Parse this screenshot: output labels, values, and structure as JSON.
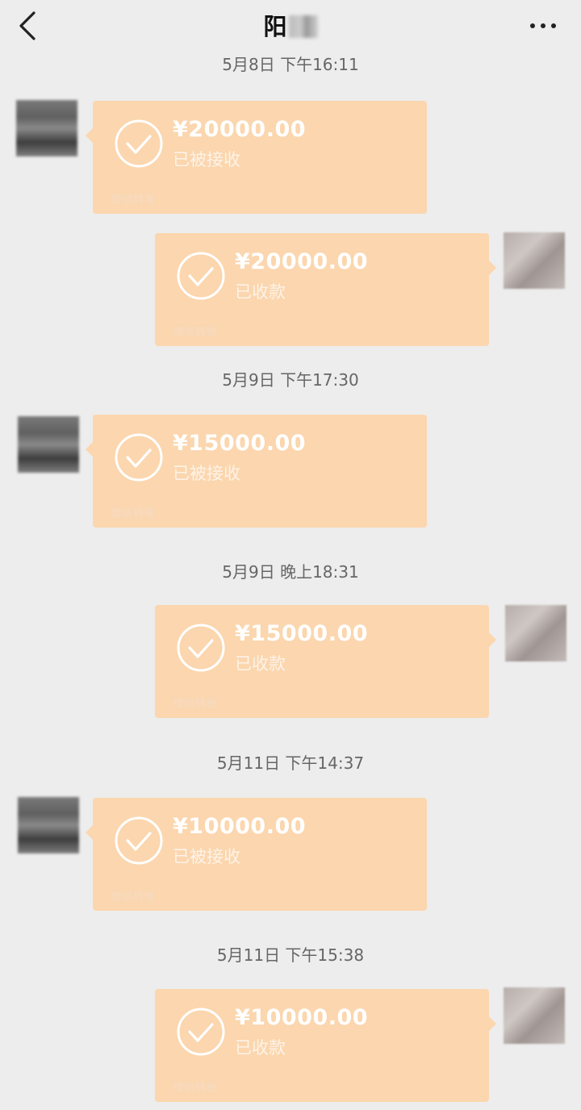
{
  "header": {
    "title": "阳"
  },
  "messages": [
    {
      "time": "5月8日 下午16:11",
      "amount": "¥20000.00",
      "status": "已被接收",
      "label": "微信转账"
    },
    {
      "amount": "¥20000.00",
      "status": "已收款",
      "label": "微信转账"
    },
    {
      "time": "5月9日 下午17:30",
      "amount": "¥15000.00",
      "status": "已被接收",
      "label": "微信转账"
    },
    {
      "time": "5月9日 晚上18:31",
      "amount": "¥15000.00",
      "status": "已收款",
      "label": "微信转账"
    },
    {
      "time": "5月11日 下午14:37",
      "amount": "¥10000.00",
      "status": "已被接收",
      "label": "微信转账"
    },
    {
      "time": "5月11日 下午15:38",
      "amount": "¥10000.00",
      "status": "已收款",
      "label": "微信转账"
    }
  ],
  "colors": {
    "background": "#ededed",
    "transfer_bubble": "#fbd6ae"
  }
}
